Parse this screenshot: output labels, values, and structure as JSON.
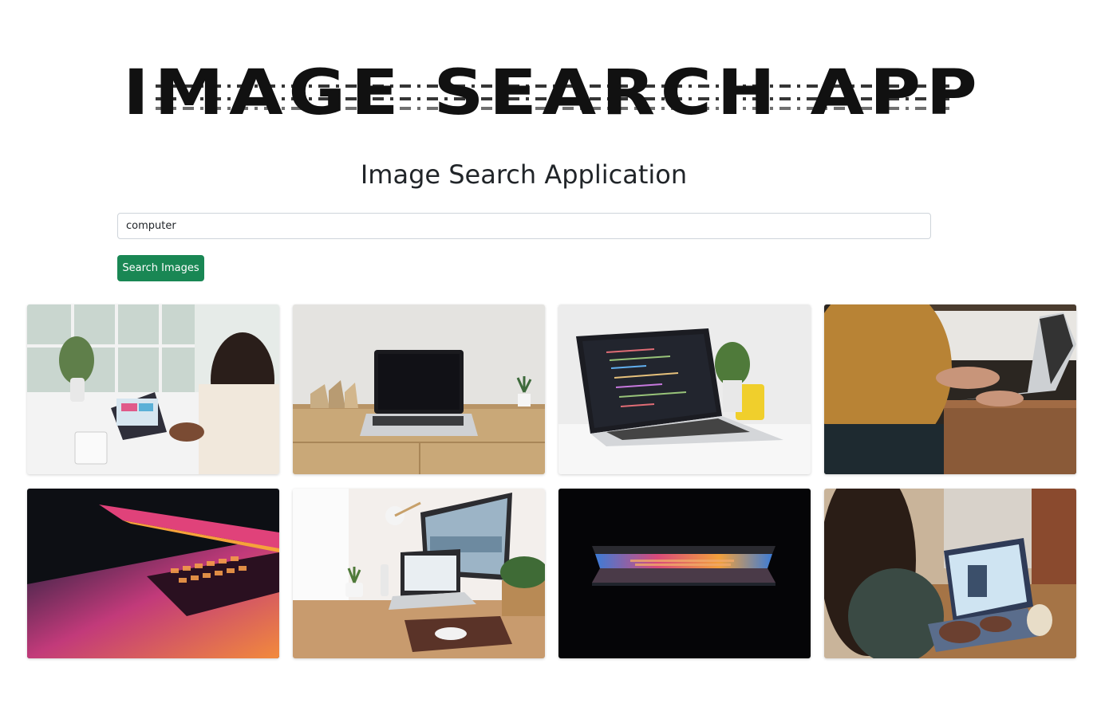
{
  "logo": {
    "text": "IMAGE SEARCH APP"
  },
  "heading": "Image Search Application",
  "search": {
    "value": "computer",
    "placeholder": ""
  },
  "button": {
    "label": "Search Images",
    "color": "#198754"
  },
  "results": [
    {
      "subject": "woman-at-laptop-by-window"
    },
    {
      "subject": "laptop-on-wooden-desk"
    },
    {
      "subject": "laptop-with-code-editor"
    },
    {
      "subject": "hands-typing-on-laptop"
    },
    {
      "subject": "laptop-glowing-keyboard"
    },
    {
      "subject": "desk-setup-monitor-and-laptop"
    },
    {
      "subject": "laptop-light-in-dark"
    },
    {
      "subject": "person-typing-on-tablet"
    }
  ]
}
